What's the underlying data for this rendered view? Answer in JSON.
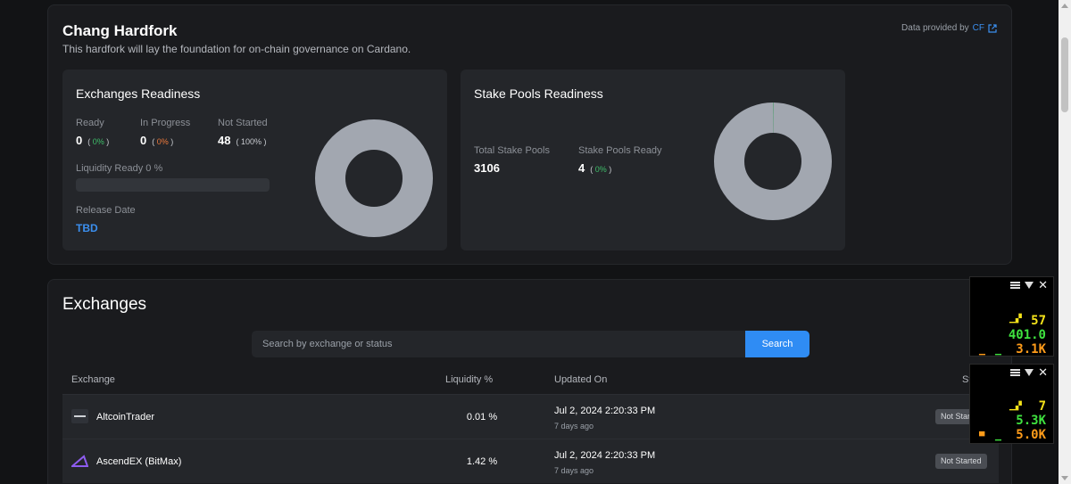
{
  "hardfork": {
    "title": "Chang Hardfork",
    "subtitle": "This hardfork will lay the foundation for on-chain governance on Cardano.",
    "provided_by_label": "Data provided by",
    "provided_by_name": "CF"
  },
  "exchanges_readiness": {
    "title": "Exchanges Readiness",
    "ready_label": "Ready",
    "ready_value": "0",
    "ready_pct": "0%",
    "in_progress_label": "In Progress",
    "in_progress_value": "0",
    "in_progress_pct": "0%",
    "not_started_label": "Not Started",
    "not_started_value": "48",
    "not_started_pct": "100%",
    "liquidity_label": "Liquidity Ready 0 %",
    "liquidity_fraction": 0,
    "release_label": "Release Date",
    "release_value": "TBD",
    "donut": {
      "ready": 0,
      "in_progress": 0,
      "not_started": 48
    }
  },
  "stake_pools_readiness": {
    "title": "Stake Pools Readiness",
    "total_label": "Total Stake Pools",
    "total_value": "3106",
    "ready_label": "Stake Pools Ready",
    "ready_value": "4",
    "ready_pct": "0%",
    "donut": {
      "ready": 4,
      "total": 3106
    }
  },
  "colors": {
    "donut_gray": "#a2a7b0",
    "ready_green": "#3fbf6a",
    "accent_blue": "#3b8fef"
  },
  "exchanges": {
    "title": "Exchanges",
    "search_placeholder": "Search by exchange or status",
    "search_button": "Search",
    "columns": {
      "exchange": "Exchange",
      "liquidity": "Liquidity %",
      "updated": "Updated On",
      "status": "Status"
    },
    "rows": [
      {
        "name": "AltcoinTrader",
        "liquidity": "0.01 %",
        "updated": "Jul 2, 2024 2:20:33 PM",
        "ago": "7 days ago",
        "status": "Not Started"
      },
      {
        "name": "AscendEX (BitMax)",
        "liquidity": "1.42 %",
        "updated": "Jul 2, 2024 2:20:33 PM",
        "ago": "7 days ago",
        "status": "Not Started"
      }
    ]
  },
  "overlay": {
    "w1": {
      "fps": "57",
      "value2": "401.0",
      "value3": "3.1K"
    },
    "w2": {
      "fps": "7",
      "value2": "5.3K",
      "value3": "5.0K"
    }
  }
}
